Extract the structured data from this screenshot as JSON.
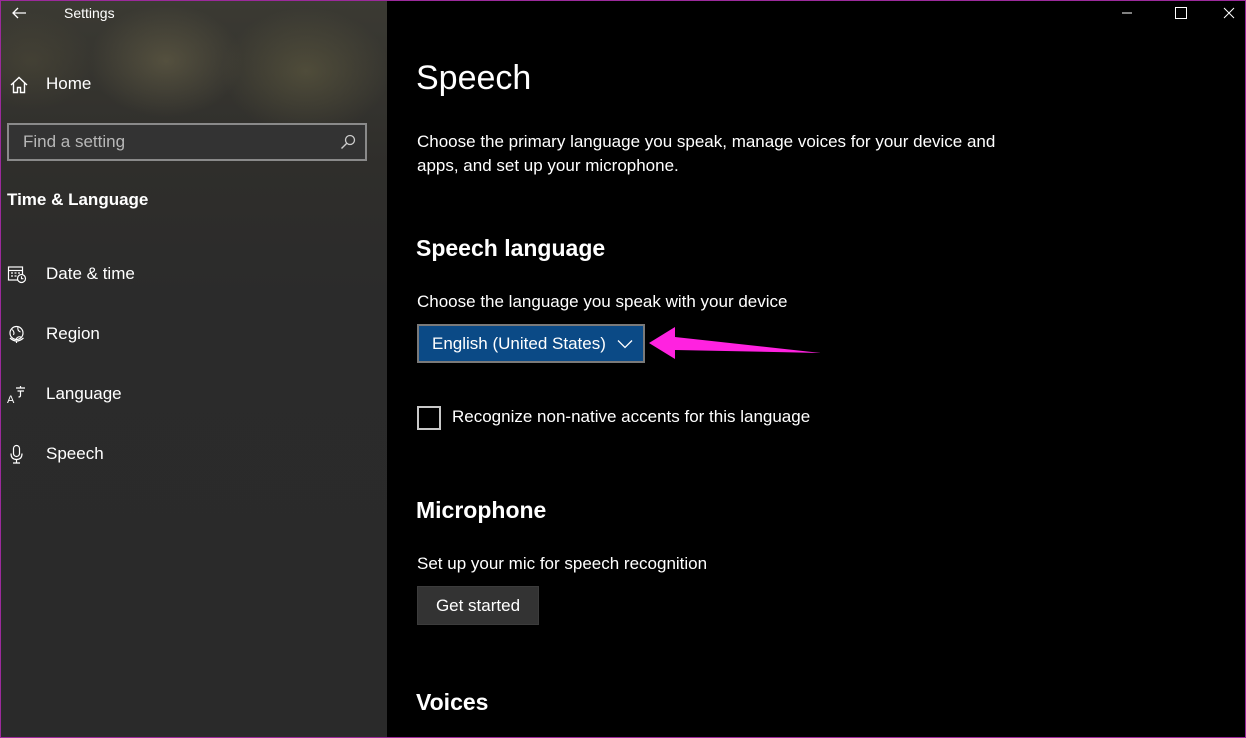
{
  "window": {
    "app_title": "Settings",
    "controls": {
      "minimize_icon": "minimize-icon",
      "maximize_icon": "maximize-icon",
      "close_icon": "close-icon"
    }
  },
  "sidebar": {
    "home_label": "Home",
    "search": {
      "placeholder": "Find a setting",
      "value": ""
    },
    "section_heading": "Time & Language",
    "items": [
      {
        "label": "Date & time",
        "icon": "calendar-clock-icon"
      },
      {
        "label": "Region",
        "icon": "globe-icon"
      },
      {
        "label": "Language",
        "icon": "language-icon"
      },
      {
        "label": "Speech",
        "icon": "microphone-icon"
      }
    ]
  },
  "main": {
    "title": "Speech",
    "description": "Choose the primary language you speak, manage voices for your device and apps, and set up your microphone.",
    "speech_language": {
      "heading": "Speech language",
      "prompt": "Choose the language you speak with your device",
      "selected": "English (United States)",
      "checkbox_label": "Recognize non-native accents for this language",
      "checkbox_checked": false
    },
    "microphone": {
      "heading": "Microphone",
      "prompt": "Set up your mic for speech recognition",
      "button_label": "Get started"
    },
    "voices": {
      "heading": "Voices"
    }
  },
  "colors": {
    "accent_dropdown": "#0b4a86",
    "annotation_arrow": "#ff22e0",
    "sidebar_bg": "#2b2b2b",
    "content_bg": "#000000"
  }
}
